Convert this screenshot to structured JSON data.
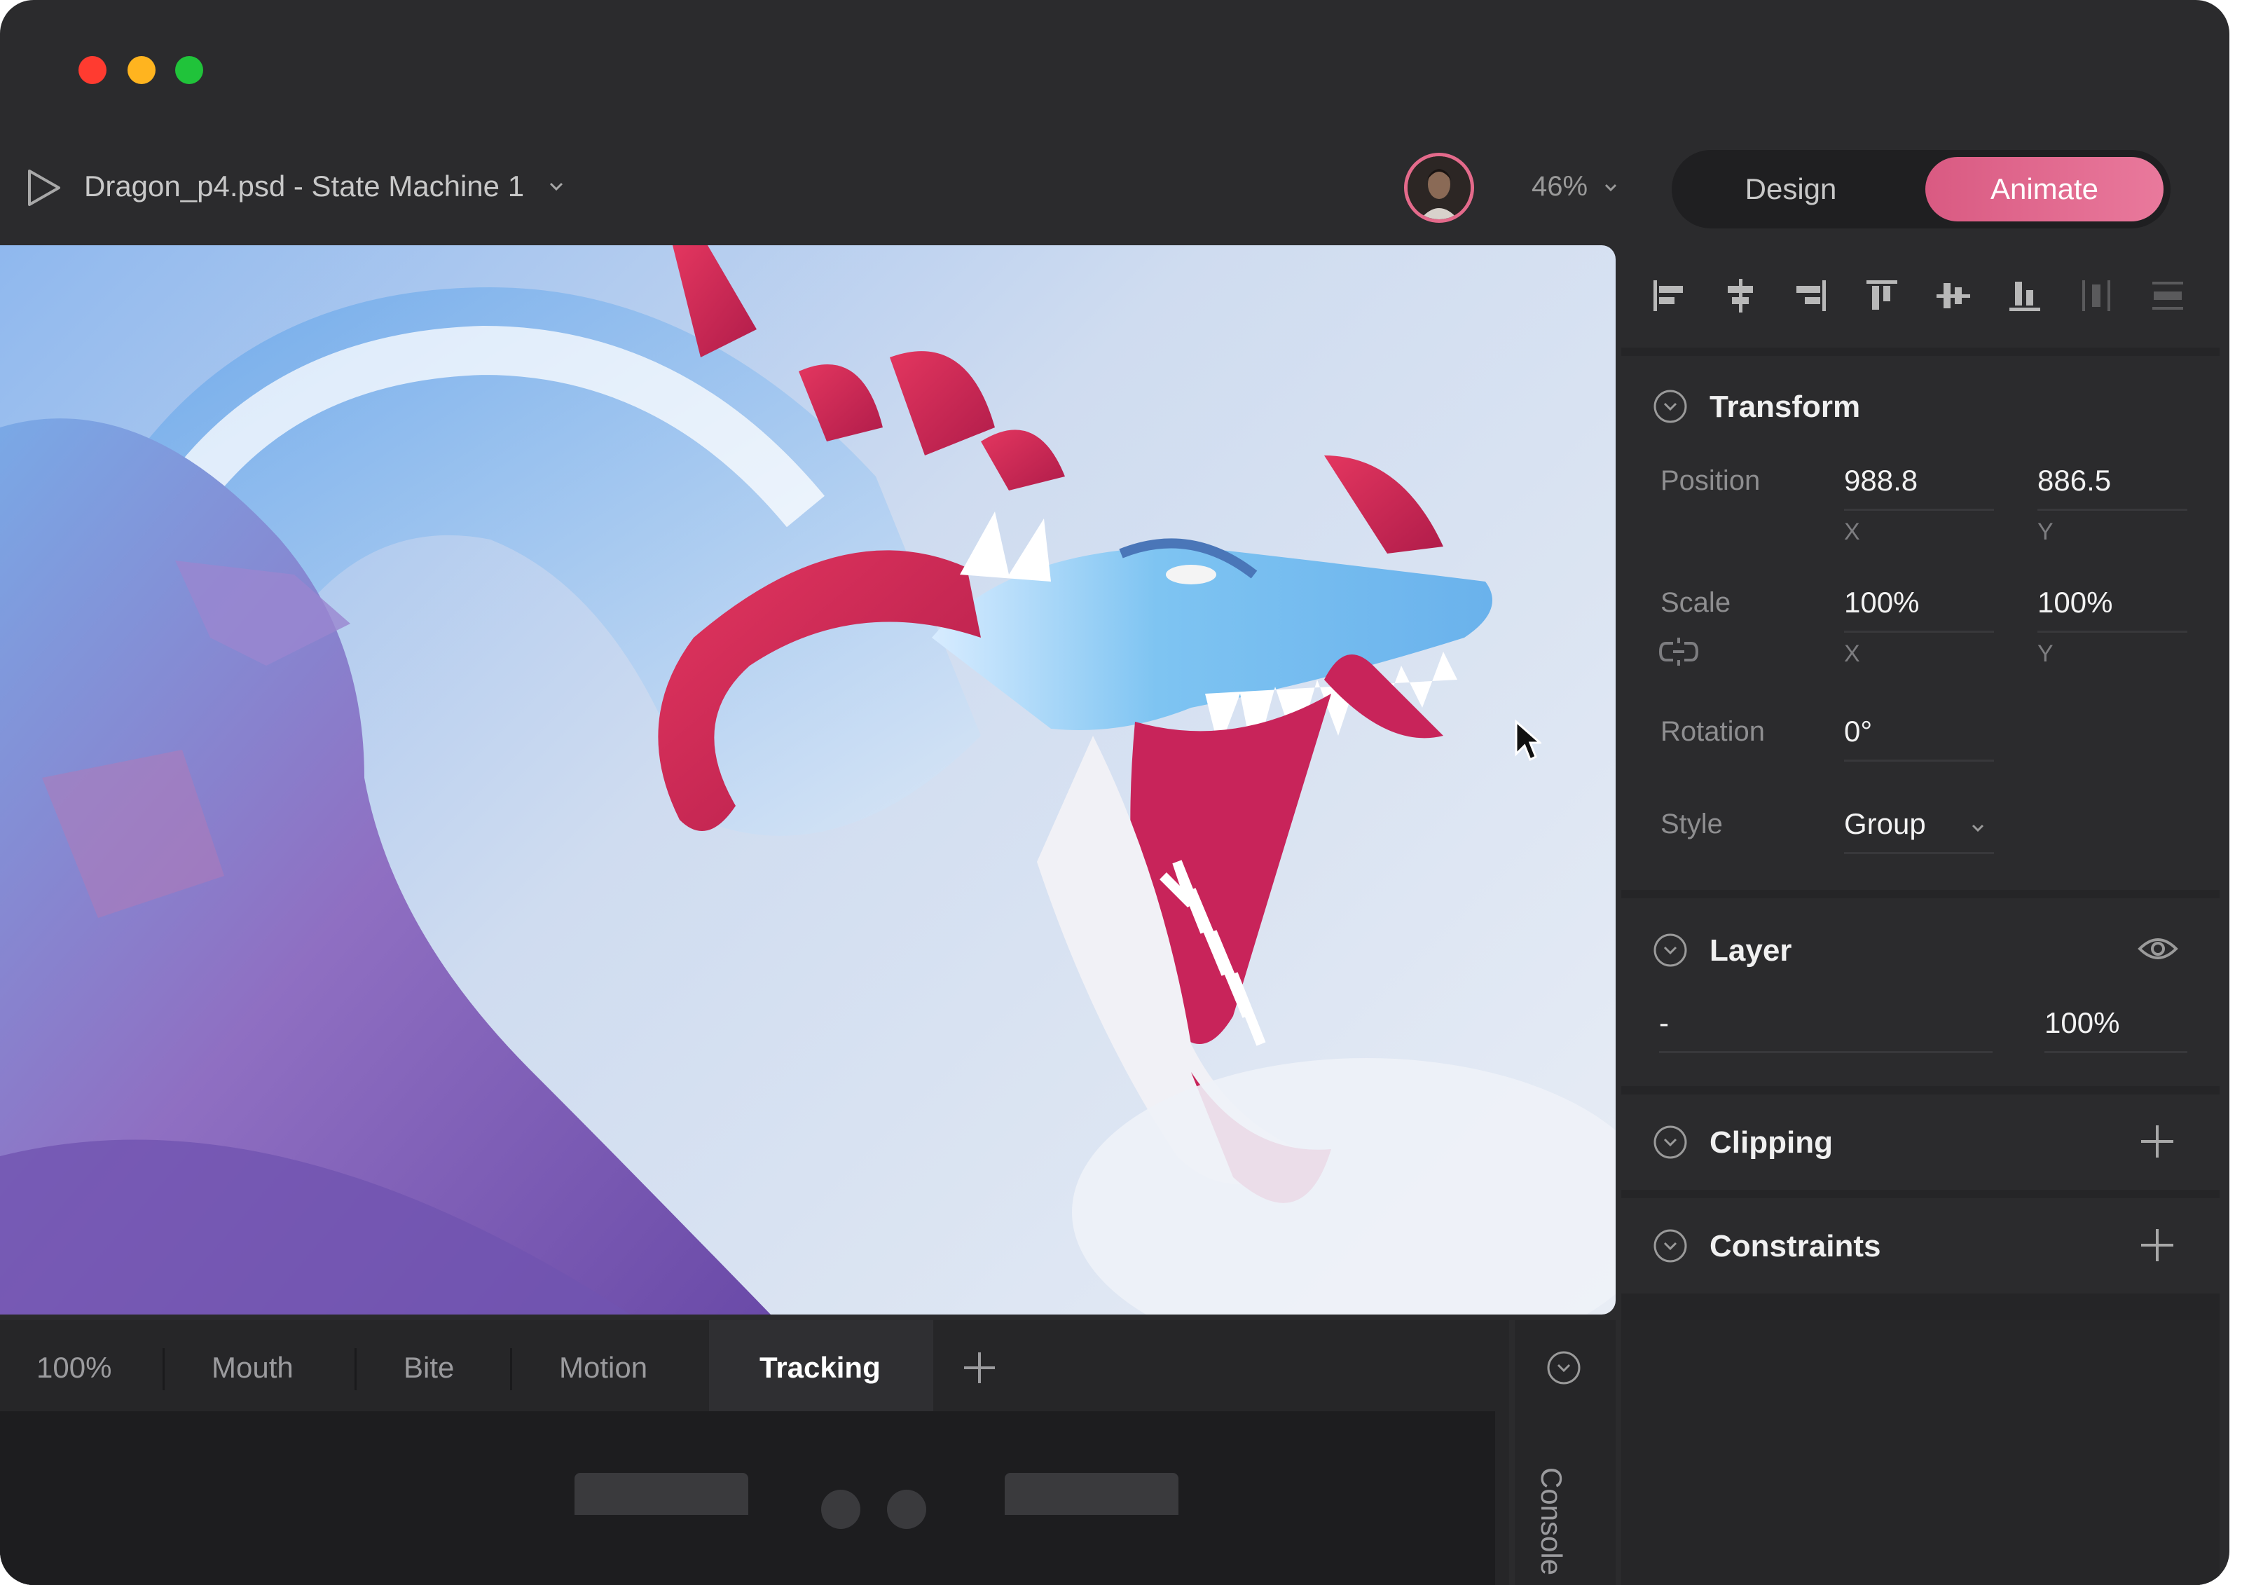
{
  "window": {
    "traffic_lights": [
      "close",
      "minimize",
      "maximize"
    ]
  },
  "toolbar": {
    "play_icon": "play-icon",
    "document_title": "Dragon_p4.psd - State Machine 1",
    "zoom": "46%",
    "mode": {
      "design_label": "Design",
      "animate_label": "Animate",
      "active": "Animate",
      "accent_color": "#e46a8b"
    }
  },
  "align_tools": [
    "align-left-icon",
    "align-center-horizontal-icon",
    "align-right-icon",
    "align-top-icon",
    "align-center-vertical-icon",
    "align-bottom-icon",
    "distribute-horizontal-icon",
    "distribute-vertical-icon"
  ],
  "transform": {
    "title": "Transform",
    "position": {
      "label": "Position",
      "x": "988.8",
      "y": "886.5",
      "x_axis": "X",
      "y_axis": "Y"
    },
    "scale": {
      "label": "Scale",
      "x": "100%",
      "y": "100%",
      "x_axis": "X",
      "y_axis": "Y"
    },
    "rotation": {
      "label": "Rotation",
      "value": "0°"
    },
    "style": {
      "label": "Style",
      "value": "Group"
    }
  },
  "layer": {
    "title": "Layer",
    "blend": "-",
    "opacity": "100%"
  },
  "clipping": {
    "title": "Clipping"
  },
  "constraints": {
    "title": "Constraints"
  },
  "timeline": {
    "tabs": [
      {
        "label": "100%"
      },
      {
        "label": "Mouth"
      },
      {
        "label": "Bite"
      },
      {
        "label": "Motion"
      },
      {
        "label": "Tracking",
        "active": true
      }
    ]
  },
  "console": {
    "label": "Console"
  }
}
